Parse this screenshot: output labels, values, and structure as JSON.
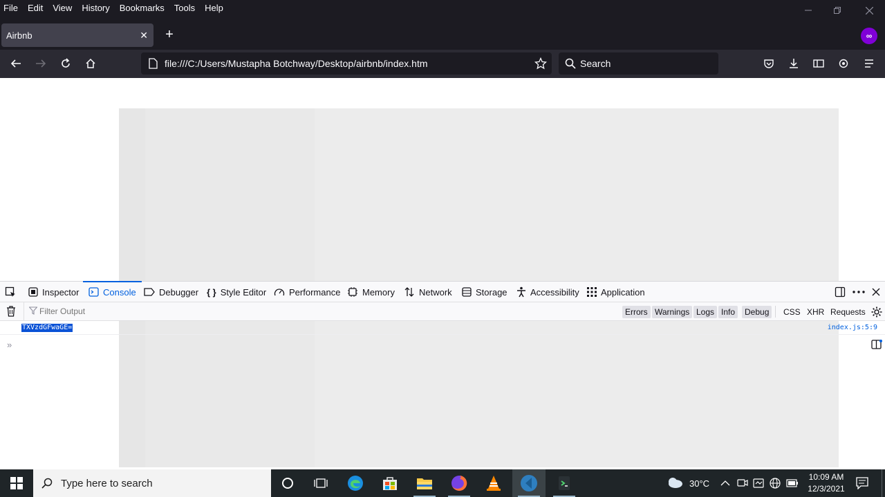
{
  "menubar": {
    "items": [
      "File",
      "Edit",
      "View",
      "History",
      "Bookmarks",
      "Tools",
      "Help"
    ]
  },
  "tab": {
    "title": "Airbnb"
  },
  "url": "file:///C:/Users/Mustapha Botchway/Desktop/airbnb/index.htm",
  "search": {
    "placeholder": "Search"
  },
  "devtools": {
    "tabs": [
      "Inspector",
      "Console",
      "Debugger",
      "Style Editor",
      "Performance",
      "Memory",
      "Network",
      "Storage",
      "Accessibility",
      "Application"
    ],
    "selected_tab": "Console",
    "filter_placeholder": "Filter Output",
    "filter_buttons": [
      "Errors",
      "Warnings",
      "Logs",
      "Info",
      "Debug"
    ],
    "filter_buttons_right": [
      "CSS",
      "XHR",
      "Requests"
    ],
    "log": {
      "message": "TXVzdGFwaGE=",
      "source": "index.js:5:9"
    }
  },
  "taskbar": {
    "search_placeholder": "Type here to search",
    "weather": "30°C",
    "time": "10:09 AM",
    "date": "12/3/2021"
  },
  "colors": {
    "accent": "#0060df",
    "chrome_dark": "#1c1b22",
    "toolbar": "#2b2a33",
    "taskbar": "#1f2528"
  }
}
